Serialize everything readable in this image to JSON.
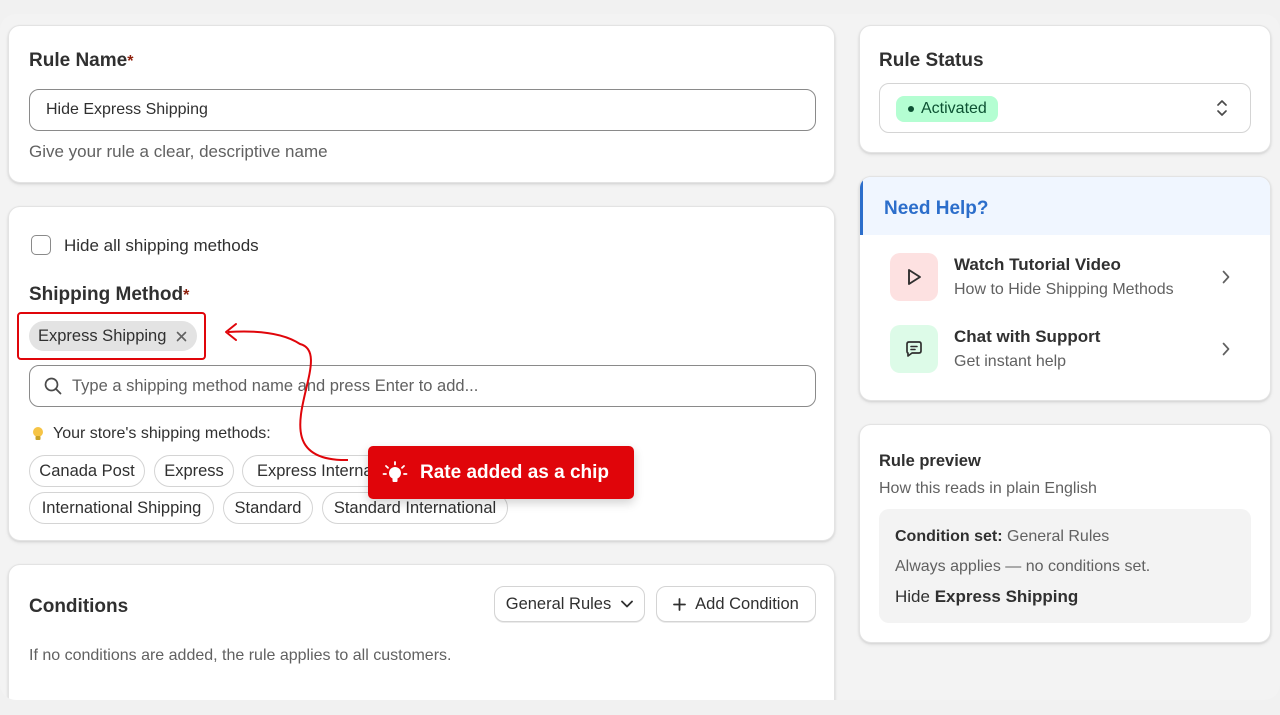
{
  "rule_name": {
    "label": "Rule Name",
    "required_mark": "*",
    "value": "Hide Express Shipping",
    "help": "Give your rule a clear, descriptive name"
  },
  "shipping": {
    "hide_all_label": "Hide all shipping methods",
    "method_label": "Shipping Method",
    "required_mark": "*",
    "selected_chip": "Express Shipping",
    "search_placeholder": "Type a shipping method name and press Enter to add...",
    "store_methods_label": "Your store's shipping methods:",
    "store_methods": [
      "Canada Post",
      "Express",
      "Express International",
      "International Shipping",
      "Standard",
      "Standard International"
    ]
  },
  "callout": {
    "text": "Rate added as a chip",
    "color": "#e0050a"
  },
  "conditions": {
    "title": "Conditions",
    "dropdown_label": "General Rules",
    "add_button": "Add Condition",
    "help": "If no conditions are added, the rule applies to all customers."
  },
  "rule_status": {
    "title": "Rule Status",
    "badge": "Activated",
    "badge_color": "#b4fed2"
  },
  "need_help": {
    "title": "Need Help?",
    "title_color": "#2c6ecb",
    "items": [
      {
        "title": "Watch Tutorial Video",
        "subtitle": "How to Hide Shipping Methods",
        "icon": "play-icon"
      },
      {
        "title": "Chat with Support",
        "subtitle": "Get instant help",
        "icon": "chat-icon"
      }
    ]
  },
  "preview": {
    "title": "Rule preview",
    "subtitle": "How this reads in plain English",
    "condition_set_label": "Condition set:",
    "condition_set_value": "General Rules",
    "always_applies": "Always applies — no conditions set.",
    "hide_prefix": "Hide",
    "hide_target": "Express Shipping"
  }
}
